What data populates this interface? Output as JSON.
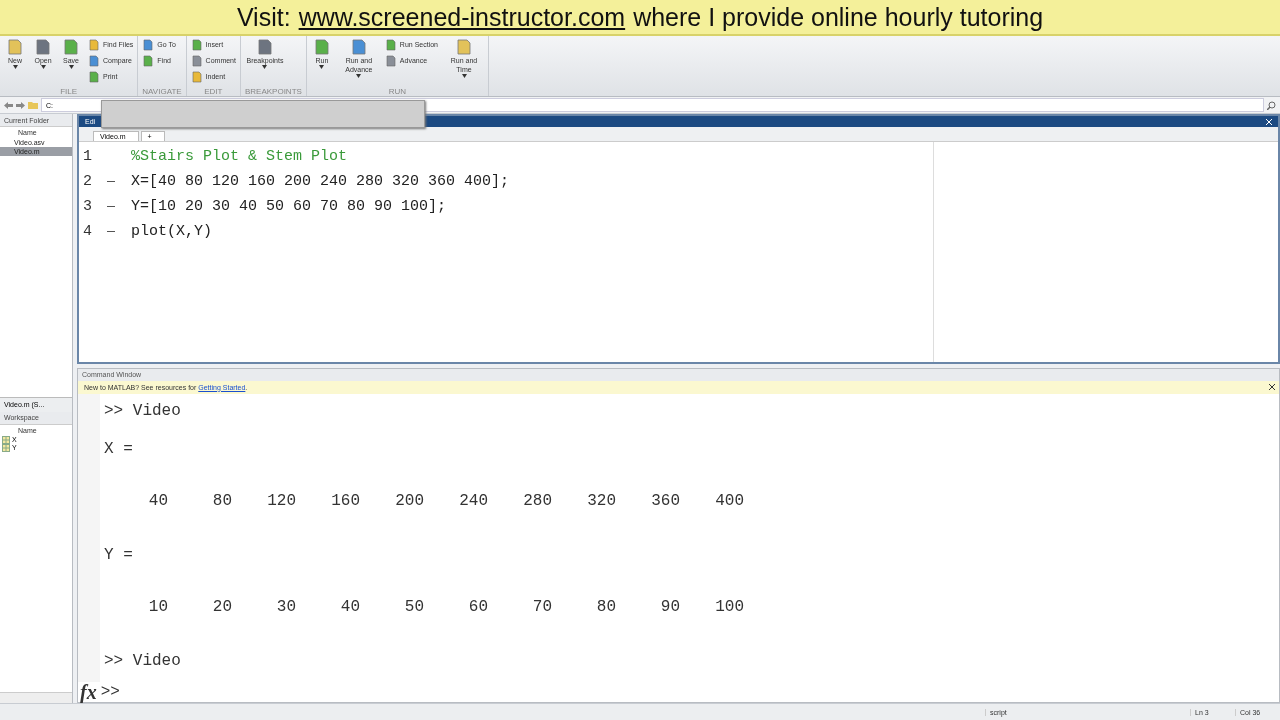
{
  "banner": {
    "prefix": "Visit:",
    "link": "www.screened-instructor.com",
    "suffix": "where I provide online hourly tutoring"
  },
  "toolstrip": [
    {
      "label": "FILE",
      "items": [
        {
          "kind": "large",
          "label": "New"
        },
        {
          "kind": "large",
          "label": "Open"
        },
        {
          "kind": "large",
          "label": "Save"
        },
        {
          "kind": "column",
          "items": [
            {
              "label": "Find Files"
            },
            {
              "label": "Compare"
            },
            {
              "label": "Print"
            }
          ]
        }
      ]
    },
    {
      "label": "NAVIGATE",
      "items": [
        {
          "kind": "column",
          "items": [
            {
              "label": "Go To"
            },
            {
              "label": "Find"
            }
          ]
        }
      ]
    },
    {
      "label": "EDIT",
      "items": [
        {
          "kind": "column",
          "items": [
            {
              "label": "Insert"
            },
            {
              "label": "Comment"
            },
            {
              "label": "Indent"
            }
          ]
        }
      ]
    },
    {
      "label": "BREAKPOINTS",
      "items": [
        {
          "kind": "large",
          "label": "Breakpoints"
        }
      ]
    },
    {
      "label": "RUN",
      "items": [
        {
          "kind": "large",
          "label": "Run"
        },
        {
          "kind": "large",
          "label": "Run and Advance"
        },
        {
          "kind": "column",
          "items": [
            {
              "label": "Run Section"
            },
            {
              "label": "Advance"
            }
          ]
        },
        {
          "kind": "large",
          "label": "Run and Time"
        }
      ]
    }
  ],
  "address": {
    "path": "C:"
  },
  "current_folder": {
    "title": "Current Folder",
    "column": "Name",
    "files": [
      {
        "name": "Video.asv",
        "selected": false
      },
      {
        "name": "Video.m",
        "selected": true
      }
    ],
    "details": "Video.m (S..."
  },
  "workspace": {
    "title": "Workspace",
    "column": "Name",
    "variables": [
      "X",
      "Y"
    ]
  },
  "editor": {
    "title": "Edi",
    "tab": "Video.m",
    "new_tab": "+",
    "lines": [
      {
        "number": "1",
        "kind": "comment",
        "text": "%Stairs Plot & Stem Plot",
        "marker": false
      },
      {
        "number": "2",
        "kind": "code",
        "text": "X=[40 80 120 160 200 240 280 320 360 400];",
        "marker": true
      },
      {
        "number": "3",
        "kind": "code",
        "text": "Y=[10 20 30 40 50 60 70 80 90 100];",
        "marker": true
      },
      {
        "number": "4",
        "kind": "code",
        "text": "plot(X,Y)",
        "marker": true
      }
    ]
  },
  "command_window": {
    "title": "Command Window",
    "notice": "New to MATLAB? See resources for",
    "notice_link": "Getting Started",
    "notice_end": ".",
    "output": [
      {
        "kind": "text",
        "text": ">> Video"
      },
      {
        "kind": "text",
        "text": "X ="
      },
      {
        "kind": "values",
        "values": [
          "40",
          "80",
          "120",
          "160",
          "200",
          "240",
          "280",
          "320",
          "360",
          "400"
        ]
      },
      {
        "kind": "text",
        "text": "Y ="
      },
      {
        "kind": "values",
        "values": [
          "10",
          "20",
          "30",
          "40",
          "50",
          "60",
          "70",
          "80",
          "90",
          "100"
        ]
      },
      {
        "kind": "text",
        "text": ">> Video"
      }
    ],
    "prompt_icon": "fx",
    "prompt": ">>"
  },
  "status_bar": {
    "mode": "script",
    "line": "Ln  3",
    "column": "Col  36"
  }
}
